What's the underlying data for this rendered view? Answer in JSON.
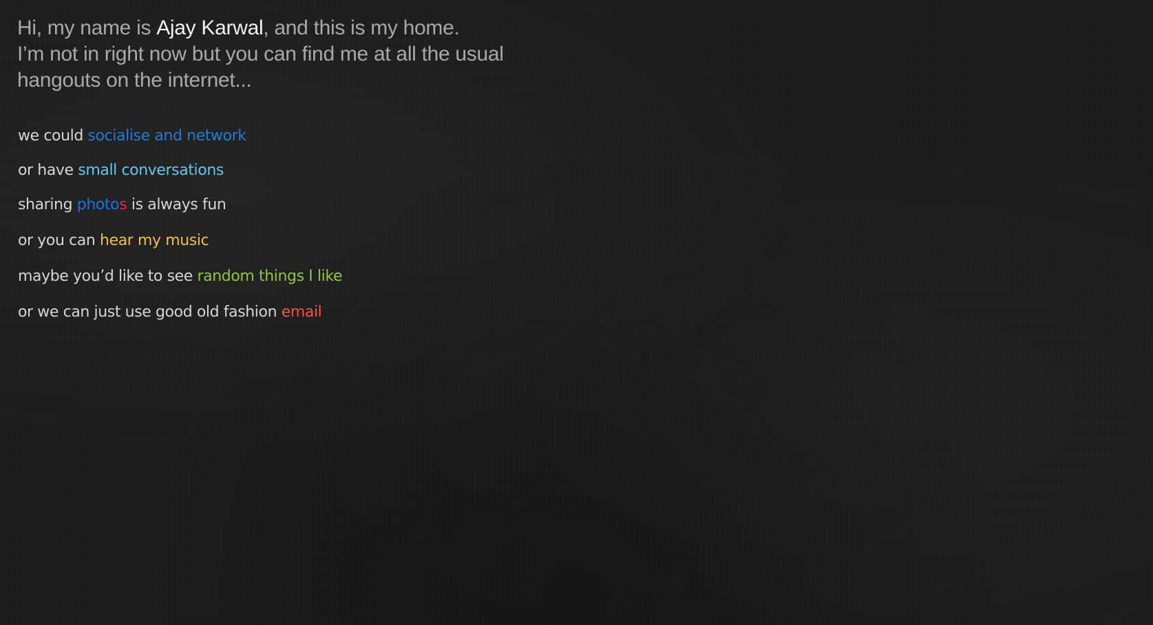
{
  "intro": {
    "greeting_prefix": "Hi, my name is ",
    "name": "Ajay Karwal",
    "greeting_suffix": ", and this is my home.",
    "line2": "I’m not in right now but you can find me at all the usual",
    "line3": "hangouts on the internet..."
  },
  "links": [
    {
      "prefix": "we could ",
      "link": "socialise and network",
      "suffix": ""
    },
    {
      "prefix": "or have ",
      "link": "small conversations",
      "suffix": ""
    },
    {
      "prefix": "sharing ",
      "link_a": "photo",
      "link_b": "s",
      "suffix": " is always fun"
    },
    {
      "prefix": "or you can ",
      "link": "hear my music",
      "suffix": ""
    },
    {
      "prefix": "maybe you’d like to see ",
      "link": "random things I like",
      "suffix": ""
    },
    {
      "prefix": "or we can just use good old fashion ",
      "link": "email",
      "suffix": ""
    }
  ],
  "colors": {
    "background": "#1c1c1c",
    "intro_text": "#a9a9a9",
    "name": "#f2f2f2",
    "body_text": "#d6d6d6",
    "socialise": "#1d7ed4",
    "conversations": "#63c7f2",
    "photos_blue": "#1a73e2",
    "photos_pink": "#e8234e",
    "music": "#f0c040",
    "random": "#8fc83c",
    "email": "#f0554a"
  }
}
